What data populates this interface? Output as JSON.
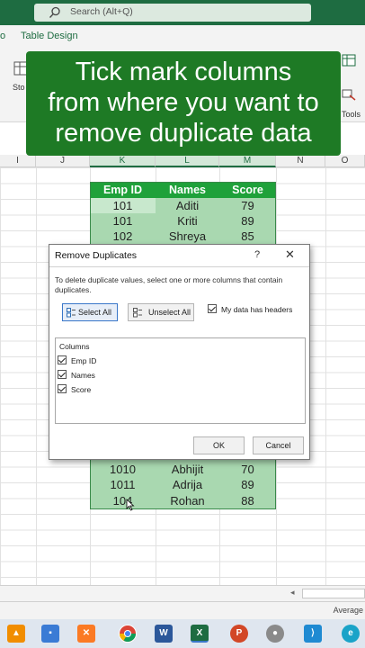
{
  "search": {
    "placeholder": "Search (Alt+Q)"
  },
  "ribbon": {
    "tabs": [
      "o",
      "Table Design"
    ],
    "left_btn_fragment": "Sto",
    "right_group_label": "Tools"
  },
  "banner": {
    "lines": [
      "Tick mark columns",
      "from where you want to",
      "remove duplicate data"
    ]
  },
  "columns": [
    "I",
    "J",
    "K",
    "L",
    "M",
    "N",
    "O"
  ],
  "table": {
    "headers": [
      "Emp ID",
      "Names",
      "Score"
    ],
    "top_rows": [
      [
        "101",
        "Aditi",
        "79"
      ],
      [
        "101",
        "Kriti",
        "89"
      ],
      [
        "102",
        "Shreya",
        "85"
      ]
    ],
    "bottom_rows": [
      [
        "1010",
        "Abhijit",
        "70"
      ],
      [
        "1011",
        "Adrija",
        "89"
      ],
      [
        "104",
        "Rohan",
        "88"
      ]
    ]
  },
  "dialog": {
    "title": "Remove Duplicates",
    "help": "?",
    "close": "✕",
    "description": "To delete duplicate values, select one or more columns that contain duplicates.",
    "select_all": "Select All",
    "unselect_all": "Unselect All",
    "headers_checkbox": "My data has headers",
    "columns_label": "Columns",
    "column_items": [
      "Emp ID",
      "Names",
      "Score"
    ],
    "ok": "OK",
    "cancel": "Cancel"
  },
  "status": {
    "right_text": "Average"
  },
  "taskbar": {
    "icons": [
      "vlc-icon",
      "files-icon",
      "xampp-icon",
      "chrome-icon",
      "word-icon",
      "excel-icon",
      "powerpoint-icon",
      "app-icon",
      "vscode-icon",
      "edge-icon"
    ]
  },
  "colors": {
    "excel_green": "#1e6c41",
    "header_green": "#1fa13a",
    "row_green": "#a9d8b0",
    "banner_green": "#1e7a25"
  }
}
